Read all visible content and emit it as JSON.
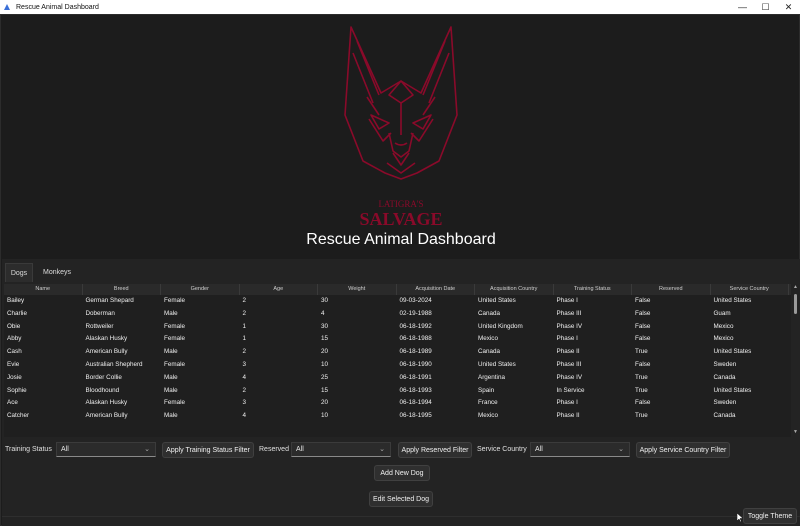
{
  "window": {
    "title": "Rescue Animal Dashboard",
    "controls": {
      "minimize": "—",
      "maximize": "☐",
      "close": "✕"
    }
  },
  "logo": {
    "text_top": "LATIGRA'S",
    "text_bottom": "SALVAGE",
    "color": "#8a0a2a"
  },
  "header": {
    "title": "Rescue Animal Dashboard"
  },
  "tabs": [
    {
      "label": "Dogs"
    },
    {
      "label": "Monkeys"
    }
  ],
  "table": {
    "columns": [
      "Name",
      "Breed",
      "Gender",
      "Age",
      "Weight",
      "Acquisition Date",
      "Acquisition Country",
      "Training Status",
      "Reserved",
      "Service Country"
    ],
    "rows": [
      [
        "Bailey",
        "German Shepard",
        "Female",
        "2",
        "30",
        "09-03-2024",
        "United States",
        "Phase I",
        "False",
        "United States"
      ],
      [
        "Charlie",
        "Doberman",
        "Male",
        "2",
        "4",
        "02-19-1988",
        "Canada",
        "Phase III",
        "False",
        "Guam"
      ],
      [
        "Obie",
        "Rottweiler",
        "Female",
        "1",
        "30",
        "06-18-1992",
        "United Kingdom",
        "Phase IV",
        "False",
        "Mexico"
      ],
      [
        "Abby",
        "Alaskan Husky",
        "Female",
        "1",
        "15",
        "06-18-1988",
        "Mexico",
        "Phase I",
        "False",
        "Mexico"
      ],
      [
        "Cash",
        "American Bully",
        "Male",
        "2",
        "20",
        "06-18-1989",
        "Canada",
        "Phase II",
        "True",
        "United States"
      ],
      [
        "Evie",
        "Australian Shepherd",
        "Female",
        "3",
        "10",
        "06-18-1990",
        "United States",
        "Phase III",
        "False",
        "Sweden"
      ],
      [
        "Josie",
        "Border Collie",
        "Male",
        "4",
        "25",
        "06-18-1991",
        "Argentina",
        "Phase IV",
        "True",
        "Canada"
      ],
      [
        "Sophie",
        "Bloodhound",
        "Male",
        "2",
        "15",
        "06-18-1993",
        "Spain",
        "In Service",
        "True",
        "United States"
      ],
      [
        "Ace",
        "Alaskan Husky",
        "Female",
        "3",
        "20",
        "06-18-1994",
        "France",
        "Phase I",
        "False",
        "Sweden"
      ],
      [
        "Catcher",
        "American Bully",
        "Male",
        "4",
        "10",
        "06-18-1995",
        "Mexico",
        "Phase II",
        "True",
        "Canada"
      ]
    ]
  },
  "filters": {
    "training_status": {
      "label": "Training Status",
      "value": "All",
      "button": "Apply Training Status Filter"
    },
    "reserved": {
      "label": "Reserved",
      "value": "All",
      "button": "Apply Reserved Filter"
    },
    "service_country": {
      "label": "Service Country",
      "value": "All",
      "button": "Apply Service Country Filter"
    }
  },
  "actions": {
    "add": "Add New Dog",
    "edit": "Edit Selected Dog",
    "toggle_theme": "Toggle Theme"
  }
}
